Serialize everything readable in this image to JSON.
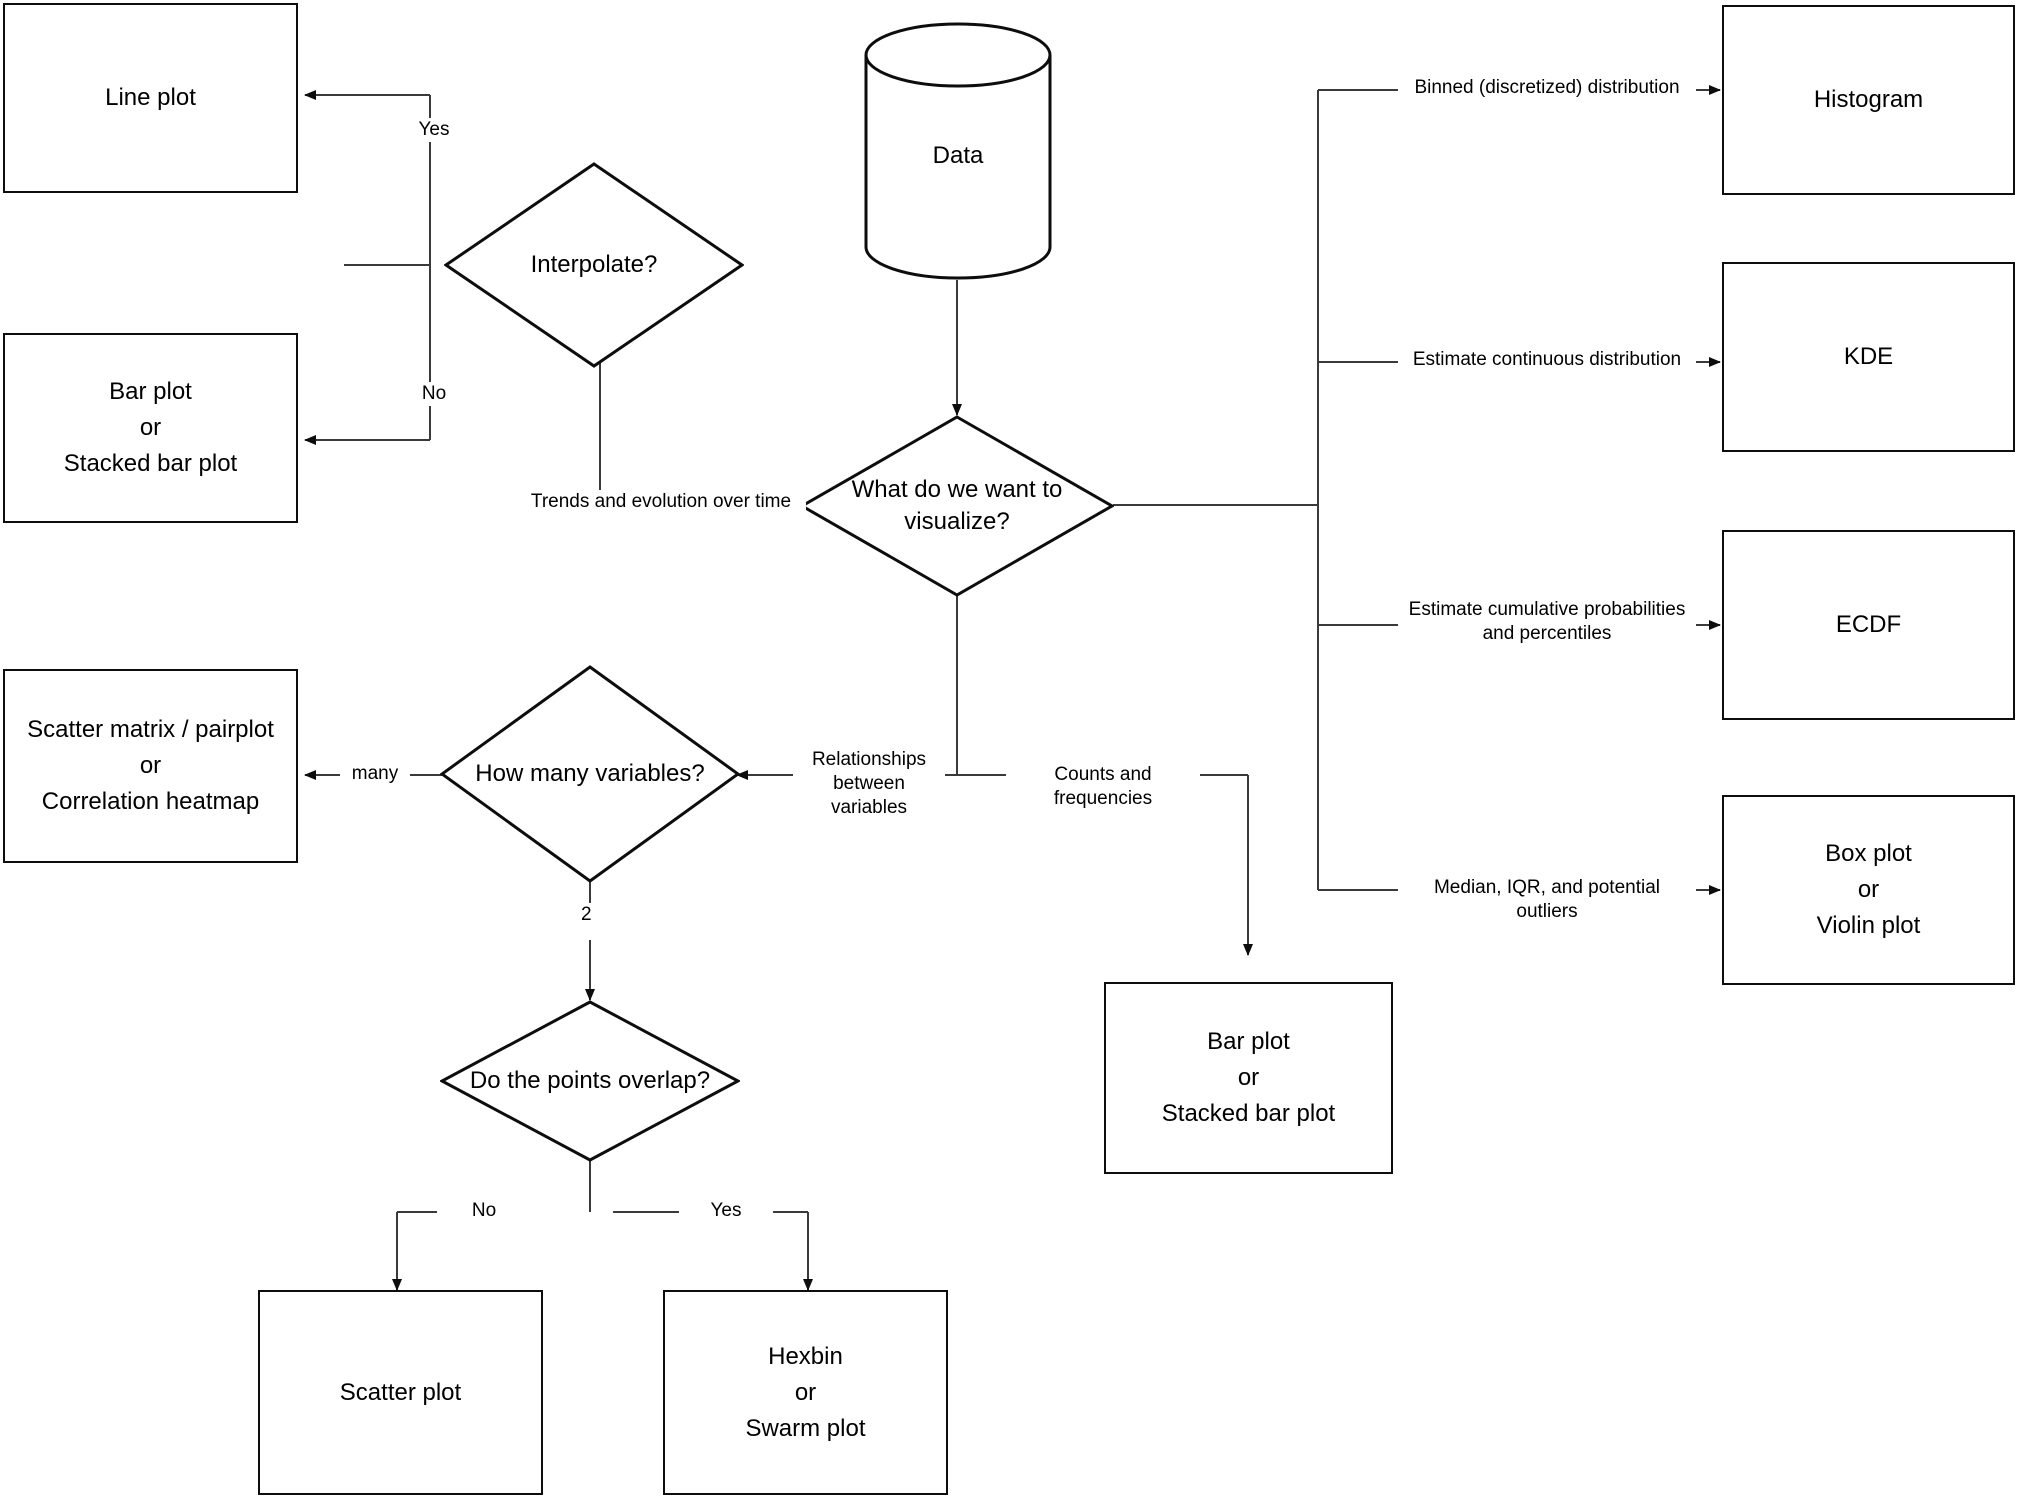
{
  "diagram": {
    "title": "Data visualization decision flowchart",
    "line_color": "#0d0d0d",
    "background": "#ffffff"
  },
  "nodes": {
    "data": {
      "label": "Data",
      "shape": "cylinder"
    },
    "line_plot": {
      "label": "Line plot",
      "shape": "box"
    },
    "bar_left": {
      "label": "Bar plot\nor\nStacked bar plot",
      "shape": "box"
    },
    "interpolate": {
      "label": "Interpolate?",
      "shape": "diamond"
    },
    "what_visualize": {
      "label": "What do we want to\nvisualize?",
      "shape": "diamond"
    },
    "how_many": {
      "label": "How many variables?",
      "shape": "diamond"
    },
    "scatter_matrix": {
      "label": "Scatter matrix / pairplot\nor\nCorrelation heatmap",
      "shape": "box"
    },
    "points_overlap": {
      "label": "Do the points overlap?",
      "shape": "diamond"
    },
    "scatter_plot": {
      "label": "Scatter plot",
      "shape": "box"
    },
    "hexbin": {
      "label": "Hexbin\nor\nSwarm plot",
      "shape": "box"
    },
    "bar_mid": {
      "label": "Bar plot\nor\nStacked bar plot",
      "shape": "box"
    },
    "histogram": {
      "label": "Histogram",
      "shape": "box"
    },
    "kde": {
      "label": "KDE",
      "shape": "box"
    },
    "ecdf": {
      "label": "ECDF",
      "shape": "box"
    },
    "box_violin": {
      "label": "Box plot\nor\nViolin plot",
      "shape": "box"
    }
  },
  "edge_labels": {
    "yes_interpolate": "Yes",
    "no_interpolate": "No",
    "trends": "Trends and evolution over time",
    "binned": "Binned (discretized) distribution",
    "continuous": "Estimate continuous distribution",
    "cumulative": "Estimate cumulative probabilities\nand percentiles",
    "median_iqr": "Median, IQR, and potential outliers",
    "relationships": "Relationships\nbetween variables",
    "counts": "Counts and frequencies",
    "many": "many",
    "two": "2",
    "no_overlap": "No",
    "yes_overlap": "Yes"
  }
}
